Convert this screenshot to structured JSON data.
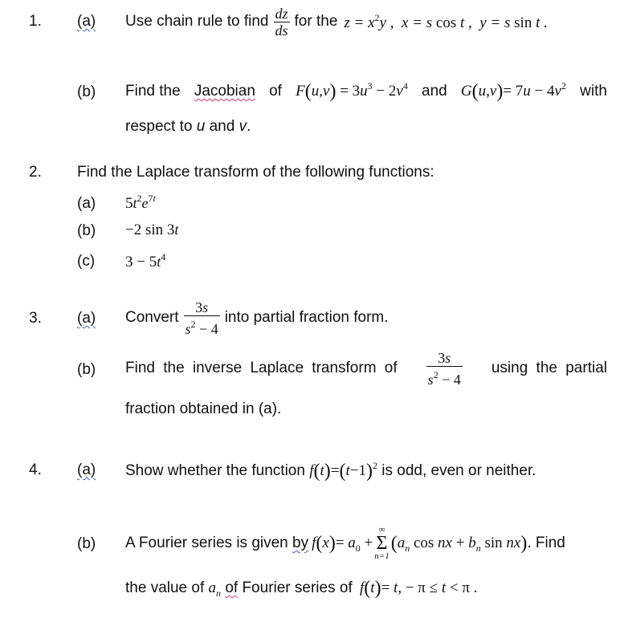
{
  "questions": [
    {
      "number": "1.",
      "parts": [
        {
          "label": "(a)",
          "text_before": "Use chain rule to find",
          "fraction": {
            "numerator": "dz",
            "denominator": "ds"
          },
          "text_after": "for the",
          "math": "z = x²y ,  x = s cos t ,  y = s sin t ."
        },
        {
          "label": "(b)",
          "text_line1_a": "Find the",
          "text_line1_word": "Jacobian",
          "text_line1_b": "of",
          "math_F": "F(u,v) = 3u³ − 2v⁴",
          "text_and": "and",
          "math_G": "G(u,v) = 7u − 4v²",
          "text_with": "with",
          "text_line2_a": "respect to",
          "var_u": "u",
          "text_line2_b": "and",
          "var_v": "v",
          "text_line2_end": "."
        }
      ]
    },
    {
      "number": "2.",
      "intro": "Find the Laplace transform of the following functions:",
      "parts": [
        {
          "label": "(a)",
          "math": "5t²e^{7t}"
        },
        {
          "label": "(b)",
          "math": "−2 sin 3t"
        },
        {
          "label": "(c)",
          "math": "3 − 5t⁴"
        }
      ]
    },
    {
      "number": "3.",
      "parts": [
        {
          "label": "(a)",
          "text_before": "Convert",
          "fraction": {
            "numerator": "3s",
            "denominator": "s² − 4"
          },
          "text_after": "into partial fraction form."
        },
        {
          "label": "(b)",
          "text_before": "Find the inverse Laplace transform of",
          "fraction": {
            "numerator": "3s",
            "denominator": "s² − 4"
          },
          "text_after": "using the partial",
          "text_line2": "fraction obtained in (a)."
        }
      ]
    },
    {
      "number": "4.",
      "parts": [
        {
          "label": "(a)",
          "text_before": "Show whether the function",
          "math": "f(t) = (t − 1)²",
          "text_after": "is odd, even or neither."
        },
        {
          "label": "(b)",
          "text_before": "A Fourier series is given",
          "text_by": "by",
          "math": "f(x) = a₀ + Σ_{n=1}^{∞} (aₙ cos nx + bₙ sin nx)",
          "sum_upper": "∞",
          "sum_lower": "n=1",
          "text_after": ". Find",
          "text_line2_a": "the value of",
          "var_an": "aₙ",
          "text_of": "of",
          "text_line2_b": "Fourier series of",
          "math_line2": "f(t) = t, − π ≤ t < π ."
        }
      ]
    }
  ]
}
